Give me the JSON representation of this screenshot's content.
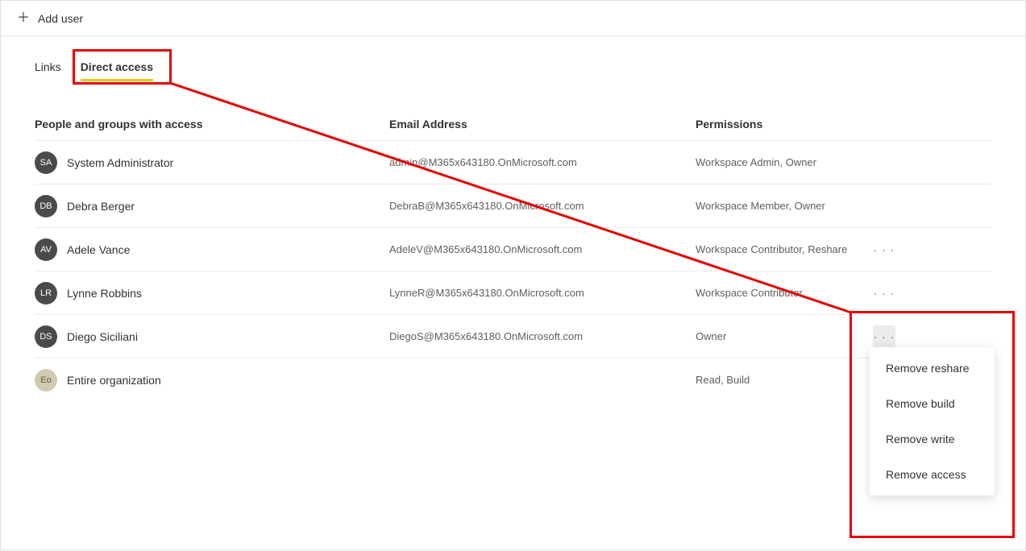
{
  "toolbar": {
    "add_user_label": "Add user"
  },
  "tabs": {
    "links_label": "Links",
    "direct_access_label": "Direct access"
  },
  "table": {
    "headers": {
      "people": "People and groups with access",
      "email": "Email Address",
      "permissions": "Permissions"
    },
    "rows": [
      {
        "initials": "SA",
        "name": "System Administrator",
        "email": "admin@M365x643180.OnMicrosoft.com",
        "permissions": "Workspace Admin, Owner",
        "has_actions": false,
        "avatar_class": ""
      },
      {
        "initials": "DB",
        "name": "Debra Berger",
        "email": "DebraB@M365x643180.OnMicrosoft.com",
        "permissions": "Workspace Member, Owner",
        "has_actions": false,
        "avatar_class": ""
      },
      {
        "initials": "AV",
        "name": "Adele Vance",
        "email": "AdeleV@M365x643180.OnMicrosoft.com",
        "permissions": "Workspace Contributor, Reshare",
        "has_actions": true,
        "avatar_class": ""
      },
      {
        "initials": "LR",
        "name": "Lynne Robbins",
        "email": "LynneR@M365x643180.OnMicrosoft.com",
        "permissions": "Workspace Contributor",
        "has_actions": true,
        "avatar_class": ""
      },
      {
        "initials": "DS",
        "name": "Diego Siciliani",
        "email": "DiegoS@M365x643180.OnMicrosoft.com",
        "permissions": "Owner",
        "has_actions": true,
        "avatar_class": "",
        "menu_open": true
      },
      {
        "initials": "Eo",
        "name": "Entire organization",
        "email": "",
        "permissions": "Read, Build",
        "has_actions": false,
        "avatar_class": "eo"
      }
    ]
  },
  "context_menu": {
    "items": [
      "Remove reshare",
      "Remove build",
      "Remove write",
      "Remove access"
    ]
  }
}
